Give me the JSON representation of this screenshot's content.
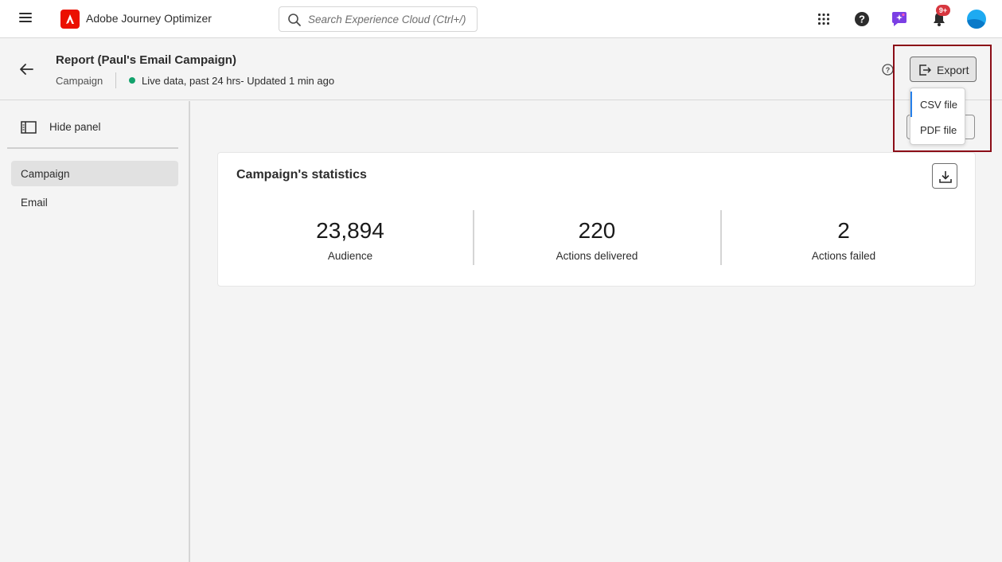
{
  "topbar": {
    "app_name": "Adobe Journey Optimizer",
    "search_placeholder": "Search Experience Cloud (Ctrl+/)",
    "notification_badge": "9+"
  },
  "header": {
    "title": "Report (Paul's Email Campaign)",
    "breadcrumb": "Campaign",
    "live_status": "Live data, past 24 hrs- Updated 1 min ago",
    "export_label": "Export"
  },
  "export_menu": {
    "items": [
      {
        "label": "CSV file"
      },
      {
        "label": "PDF file"
      }
    ]
  },
  "sidebar": {
    "hide_panel_label": "Hide panel",
    "items": [
      {
        "label": "Campaign",
        "active": true
      },
      {
        "label": "Email",
        "active": false
      }
    ]
  },
  "card": {
    "title": "Campaign's statistics",
    "stats": [
      {
        "value": "23,894",
        "label": "Audience"
      },
      {
        "value": "220",
        "label": "Actions delivered"
      },
      {
        "value": "2",
        "label": "Actions failed"
      }
    ]
  },
  "colors": {
    "brand": "#eb1000",
    "live_dot": "#12a26c",
    "notification_badge": "#d7373f",
    "highlight_frame": "#8b0d17",
    "focus_indicator": "#2680eb"
  }
}
